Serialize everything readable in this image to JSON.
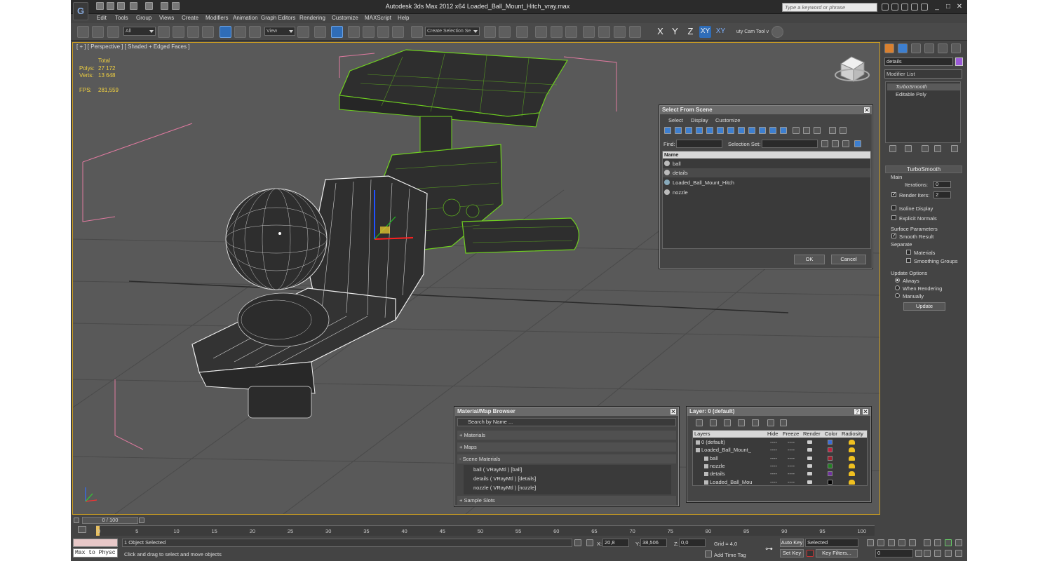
{
  "title": "Autodesk 3ds Max  2012 x64     Loaded_Ball_Mount_Hitch_vray.max",
  "search_placeholder": "Type a keyword or phrase",
  "menu": [
    "Edit",
    "Tools",
    "Group",
    "Views",
    "Create",
    "Modifiers",
    "Animation",
    "Graph Editors",
    "Rendering",
    "Customize",
    "MAXScript",
    "Help"
  ],
  "toolbar": {
    "filter": "All",
    "ref_coord": "View",
    "sel_set_placeholder": "Create Selection Se",
    "axis_x": "X",
    "axis_y": "Y",
    "axis_z": "Z",
    "axis_xy": "XY",
    "axis_xy2": "XY",
    "utility": "uty Cam Tool v"
  },
  "viewport": {
    "label": "[ + ] [ Perspective ] [ Shaded + Edged Faces ]",
    "stats": {
      "total_label": "Total",
      "polys_label": "Polys:",
      "polys": "27 172",
      "verts_label": "Verts:",
      "verts": "13 648",
      "fps_label": "FPS:",
      "fps": "281,559"
    }
  },
  "select_from_scene": {
    "title": "Select From Scene",
    "menu": [
      "Select",
      "Display",
      "Customize"
    ],
    "find_label": "Find:",
    "selset_label": "Selection Set:",
    "col_name": "Name",
    "items": [
      "ball",
      "details",
      "Loaded_Ball_Mount_Hitch",
      "nozzle"
    ],
    "ok": "OK",
    "cancel": "Cancel"
  },
  "material_browser": {
    "title": "Material/Map Browser",
    "search": "Search by Name ...",
    "sections": [
      "+ Materials",
      "+ Maps",
      "- Scene Materials"
    ],
    "scene_materials": [
      "ball  ( VRayMtl ) [ball]",
      "details  ( VRayMtl ) [details]",
      "nozzle  ( VRayMtl ) [nozzle]"
    ],
    "sample_slots": "+ Sample Slots"
  },
  "layer_dialog": {
    "title": "Layer: 0 (default)",
    "columns": [
      "Layers",
      "Hide",
      "Freeze",
      "Render",
      "Color",
      "Radiosity"
    ],
    "rows": [
      {
        "name": "0 (default)",
        "hide": "----",
        "freeze": "----",
        "color": "#3a6cd8"
      },
      {
        "name": "Loaded_Ball_Mount_",
        "hide": "----",
        "freeze": "----",
        "color": "#c02040"
      },
      {
        "name": "ball",
        "hide": "----",
        "freeze": "----",
        "color": "#a02030"
      },
      {
        "name": "nozzle",
        "hide": "----",
        "freeze": "----",
        "color": "#208020"
      },
      {
        "name": "details",
        "hide": "----",
        "freeze": "----",
        "color": "#7030a0"
      },
      {
        "name": "Loaded_Ball_Mou",
        "hide": "----",
        "freeze": "----",
        "color": "#000000"
      }
    ]
  },
  "command_panel": {
    "object_name": "details",
    "object_color": "#9b5ad8",
    "modifier_list": "Modifier List",
    "stack": [
      "TurboSmooth",
      "Editable Poly"
    ],
    "turbosmooth": {
      "title": "TurboSmooth",
      "main": "Main",
      "iterations_label": "Iterations:",
      "iterations": "0",
      "render_iters_label": "Render Iters:",
      "render_iters": "2",
      "isoline": "Isoline Display",
      "explicit": "Explicit Normals",
      "surface_params": "Surface Parameters",
      "smooth_result": "Smooth Result",
      "separate": "Separate",
      "materials": "Materials",
      "smoothing_groups": "Smoothing Groups",
      "update_options": "Update Options",
      "always": "Always",
      "when_rendering": "When Rendering",
      "manually": "Manually",
      "update": "Update"
    }
  },
  "timeline": {
    "frame": "0 / 100",
    "ticks": [
      "0",
      "5",
      "10",
      "15",
      "20",
      "25",
      "30",
      "35",
      "40",
      "45",
      "50",
      "55",
      "60",
      "65",
      "70",
      "75",
      "80",
      "85",
      "90",
      "95",
      "100"
    ]
  },
  "status": {
    "maxscript": "Max to Physc",
    "selected": "1 Object Selected",
    "prompt": "Click and drag to select and move objects",
    "x_label": "X:",
    "x": "20,8",
    "y_label": "Y:",
    "y": "38,506",
    "z_label": "Z:",
    "z": "0,0",
    "grid": "Grid = 4,0",
    "add_time_tag": "Add Time Tag",
    "auto_key": "Auto Key",
    "set_key": "Set Key",
    "key_sel": "Selected",
    "key_filters": "Key Filters...",
    "frame_field": "0"
  }
}
